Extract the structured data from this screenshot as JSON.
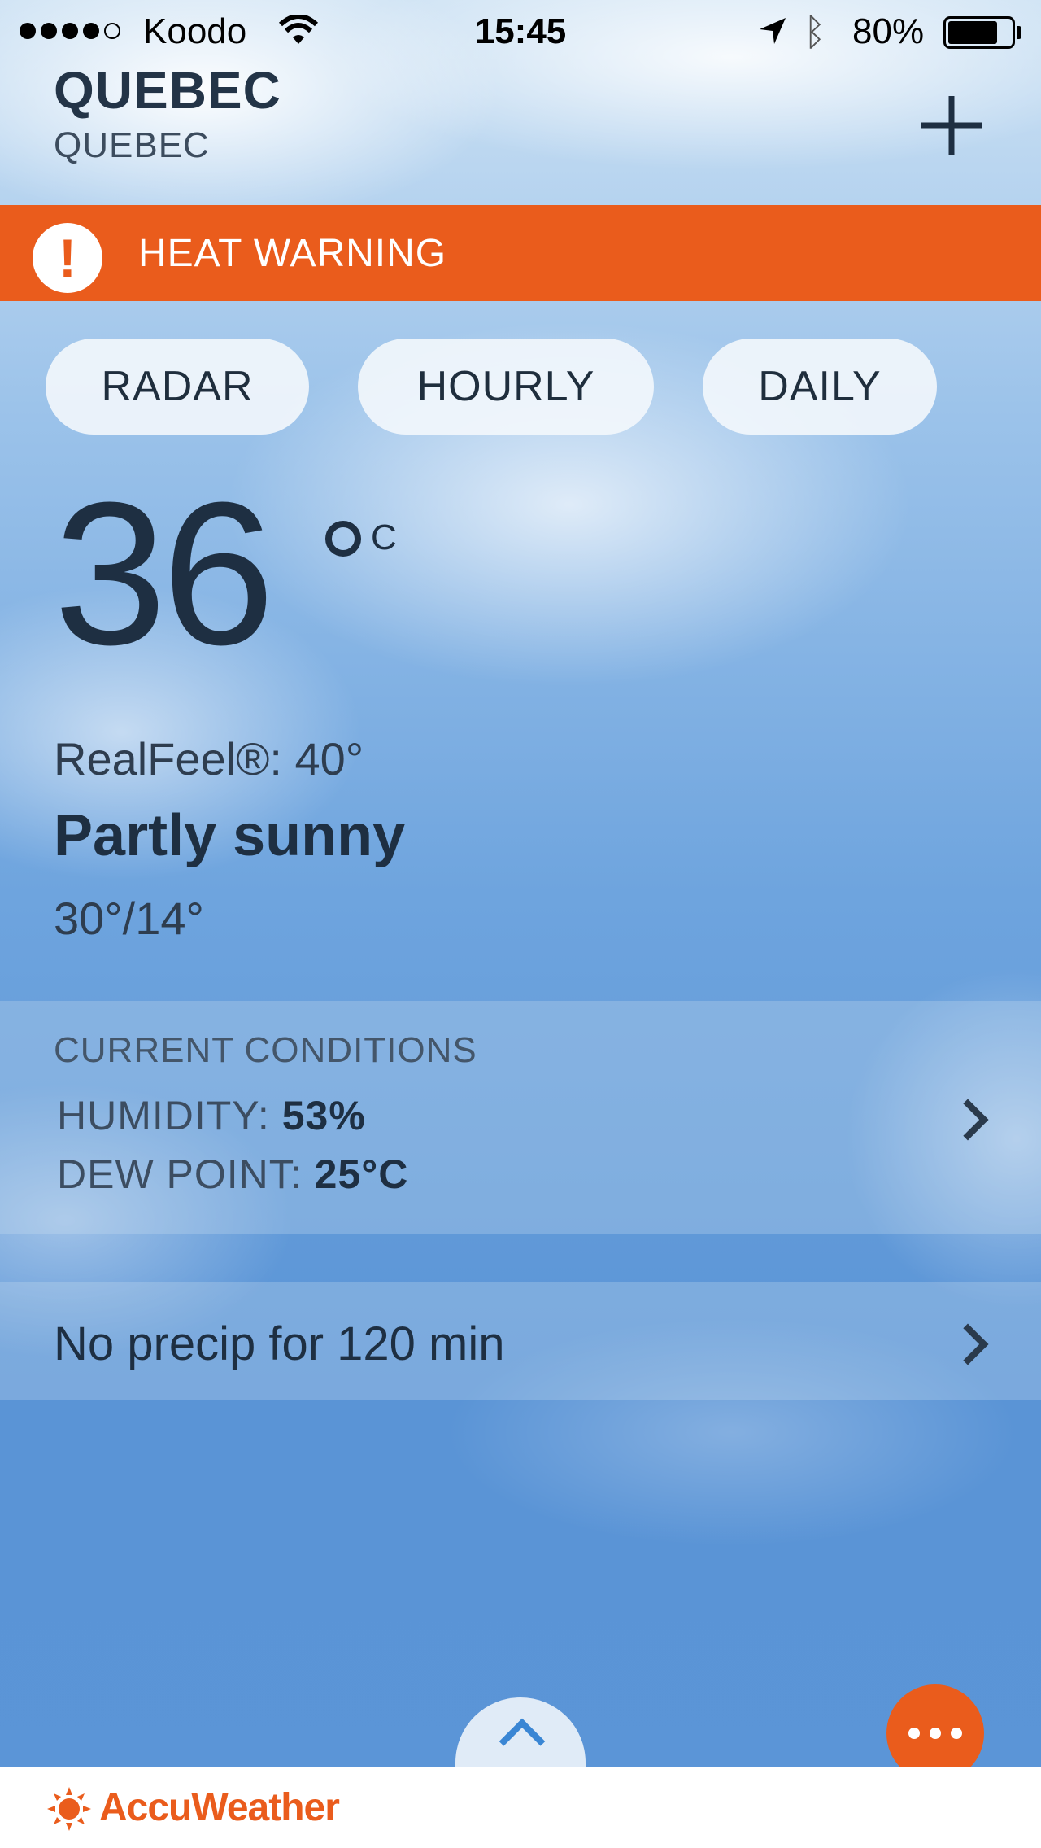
{
  "status_bar": {
    "carrier": "Koodo",
    "time": "15:45",
    "battery_percent": "80%",
    "battery_level": 0.8,
    "signal_bars_filled": 4,
    "signal_bars_total": 5
  },
  "location": {
    "city": "QUEBEC",
    "region": "QUEBEC"
  },
  "alert": {
    "icon": "exclamation-icon",
    "text": "HEAT WARNING",
    "color": "#ea5c1c"
  },
  "tabs": [
    {
      "label": "RADAR"
    },
    {
      "label": "HOURLY"
    },
    {
      "label": "DAILY"
    }
  ],
  "current": {
    "temperature": "36",
    "unit": "C",
    "realfeel": "RealFeel®: 40°",
    "condition": "Partly sunny",
    "hi_lo": "30°/14°"
  },
  "conditions_panel": {
    "title": "CURRENT CONDITIONS",
    "humidity_label": "HUMIDITY:",
    "humidity_value": "53%",
    "dew_point_label": "DEW POINT:",
    "dew_point_value": "25°C"
  },
  "precip": {
    "text": "No precip for 120 min"
  },
  "footer": {
    "brand": "AccuWeather",
    "brand_color": "#ea5c1c"
  }
}
